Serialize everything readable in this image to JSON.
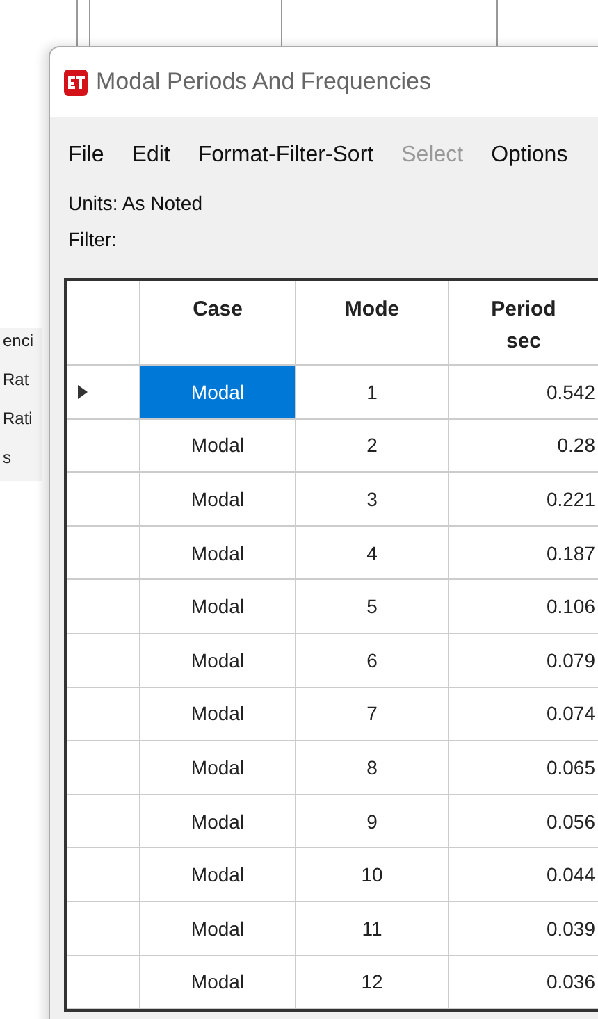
{
  "background_window": {
    "fragments": [
      "enci",
      "Rat",
      "Rati",
      "s"
    ]
  },
  "window": {
    "title": "Modal Periods And Frequencies"
  },
  "menu": [
    {
      "label": "File",
      "disabled": false
    },
    {
      "label": "Edit",
      "disabled": false
    },
    {
      "label": "Format-Filter-Sort",
      "disabled": false
    },
    {
      "label": "Select",
      "disabled": true
    },
    {
      "label": "Options",
      "disabled": false
    }
  ],
  "units": "Units:  As Noted",
  "filter": "Filter:",
  "table": {
    "columns": [
      {
        "label": "Case"
      },
      {
        "label": "Mode"
      },
      {
        "label": "Period",
        "unit": "sec"
      }
    ],
    "rows": [
      {
        "case": "Modal",
        "mode": "1",
        "period": "0.542",
        "selected": true
      },
      {
        "case": "Modal",
        "mode": "2",
        "period": "0.28",
        "selected": false
      },
      {
        "case": "Modal",
        "mode": "3",
        "period": "0.221",
        "selected": false
      },
      {
        "case": "Modal",
        "mode": "4",
        "period": "0.187",
        "selected": false
      },
      {
        "case": "Modal",
        "mode": "5",
        "period": "0.106",
        "selected": false
      },
      {
        "case": "Modal",
        "mode": "6",
        "period": "0.079",
        "selected": false
      },
      {
        "case": "Modal",
        "mode": "7",
        "period": "0.074",
        "selected": false
      },
      {
        "case": "Modal",
        "mode": "8",
        "period": "0.065",
        "selected": false
      },
      {
        "case": "Modal",
        "mode": "9",
        "period": "0.056",
        "selected": false
      },
      {
        "case": "Modal",
        "mode": "10",
        "period": "0.044",
        "selected": false
      },
      {
        "case": "Modal",
        "mode": "11",
        "period": "0.039",
        "selected": false
      },
      {
        "case": "Modal",
        "mode": "12",
        "period": "0.036",
        "selected": false
      }
    ]
  }
}
